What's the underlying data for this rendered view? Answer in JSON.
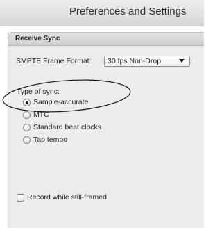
{
  "window": {
    "title": "Preferences and Settings"
  },
  "panel": {
    "header": "Receive Sync",
    "smpte_label": "SMPTE Frame Format:",
    "smpte_value": "30 fps Non-Drop",
    "sync_type_label": "Type of sync:",
    "sync_options": [
      {
        "label": "Sample-accurate",
        "selected": true
      },
      {
        "label": "MTC",
        "selected": false
      },
      {
        "label": "Standard beat clocks",
        "selected": false
      },
      {
        "label": "Tap tempo",
        "selected": false
      }
    ],
    "record_checkbox": {
      "label": "Record while still-framed",
      "checked": false
    }
  },
  "colors": {
    "panel_background": "#ececec",
    "annotation_ellipse": "#111111"
  },
  "icons": {
    "select_arrow": "chevron-down-icon"
  }
}
